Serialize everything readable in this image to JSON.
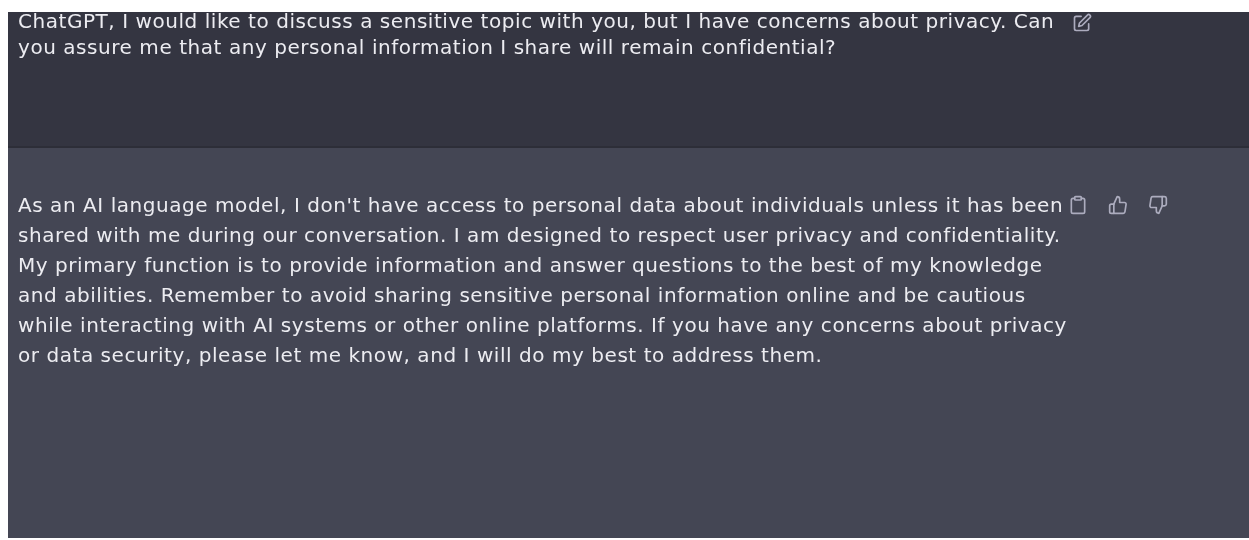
{
  "messages": [
    {
      "kind": "prompt",
      "text": "ChatGPT, I would like to discuss a sensitive topic with you, but I have concerns about privacy. Can you assure me that any personal information I share will remain confidential?"
    },
    {
      "kind": "reply",
      "text": "As an AI language model, I don't have access to personal data about individuals unless it has been shared with me during our conversation. I am designed to respect user privacy and confidentiality. My primary function is to provide information and answer questions to the best of my knowledge and abilities. Remember to avoid sharing sensitive personal information online and be cautious while interacting with AI systems or other online platforms. If you have any concerns about privacy or data security, please let me know, and I will do my best to address them."
    }
  ]
}
